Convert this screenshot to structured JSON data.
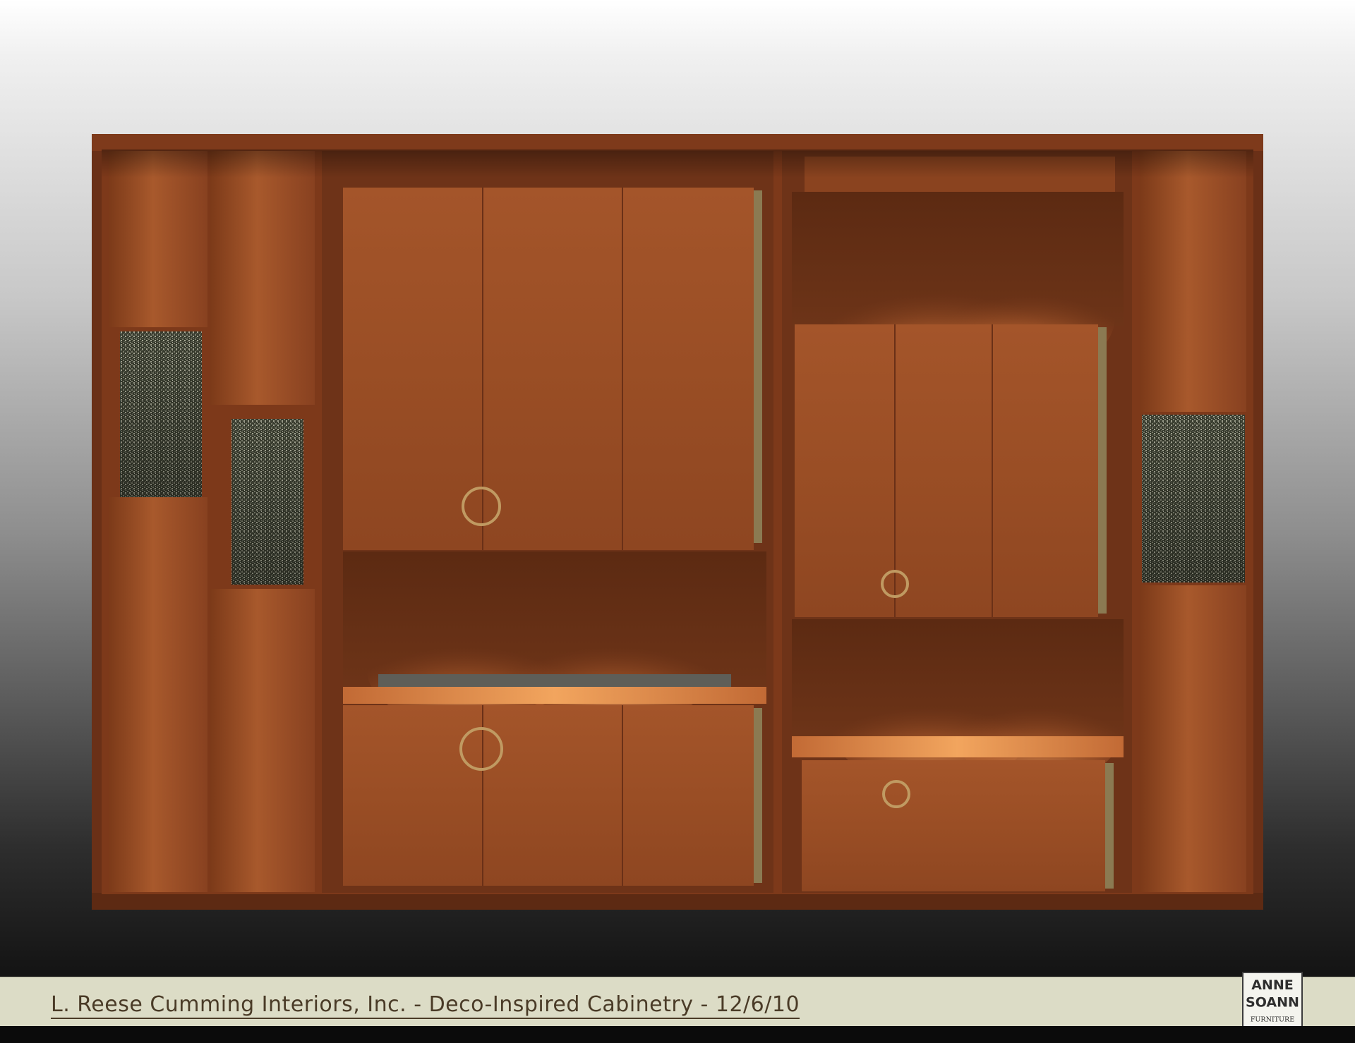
{
  "caption": "L. Reese Cumming Interiors, Inc. - Deco-Inspired Cabinetry - 12/6/10",
  "logo": {
    "line1": "ANNE",
    "line2": "SOANN",
    "line3": "FURNITURE"
  },
  "colors": {
    "wood": "#9a4e26",
    "wood_dark": "#5a2a12",
    "brass": "#b8925c",
    "caption_bar": "#dcdcc6",
    "caption_text": "#4a3b27"
  }
}
